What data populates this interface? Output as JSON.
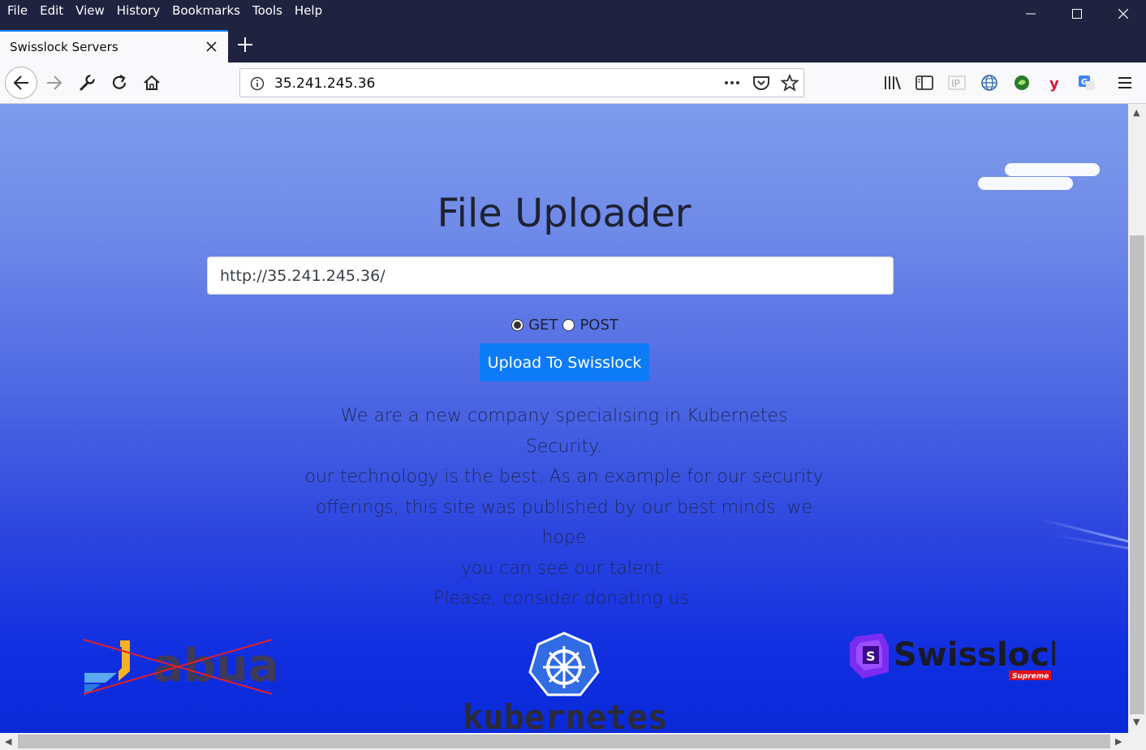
{
  "menu": {
    "file": "File",
    "edit": "Edit",
    "view": "View",
    "history": "History",
    "bookmarks": "Bookmarks",
    "tools": "Tools",
    "help": "Help"
  },
  "tab": {
    "title": "Swisslock Servers"
  },
  "urlbar": {
    "url": "35.241.245.36"
  },
  "page": {
    "title": "File Uploader",
    "url_input_value": "http://35.241.245.36/",
    "method_get": "GET",
    "method_post": "POST",
    "selected_method": "GET",
    "upload_button": "Upload To Swisslock",
    "description_lines": [
      "We are a new company specialising in Kubernetes Security.",
      "our technology is the best. As an example for our security",
      "offerings, this site was published by our best minds. we hope",
      "you can see our talent.",
      "Please, consider donating us."
    ],
    "logos": {
      "left": "abua",
      "center": "kubernetes",
      "right": "Swisslock",
      "right_badge": "Supreme"
    }
  },
  "colors": {
    "accent": "#0d7bf6",
    "titlebar": "#202340",
    "gradient_top": "#7d9cec",
    "gradient_bottom": "#0a2ad8"
  },
  "icons": {
    "back": "back-arrow-icon",
    "forward": "forward-arrow-icon",
    "tools": "wrench-icon",
    "reload": "reload-icon",
    "home": "home-icon",
    "info": "info-icon",
    "more": "more-dots-icon",
    "pocket": "pocket-icon",
    "bookmark": "star-icon",
    "library": "library-icon",
    "sidebar": "sidebar-icon",
    "ip": "ip-icon",
    "globe": "globe-icon",
    "extension_green": "green-extension-icon",
    "extension_y": "y-extension-icon",
    "translate": "translate-icon",
    "menu": "hamburger-menu-icon"
  }
}
